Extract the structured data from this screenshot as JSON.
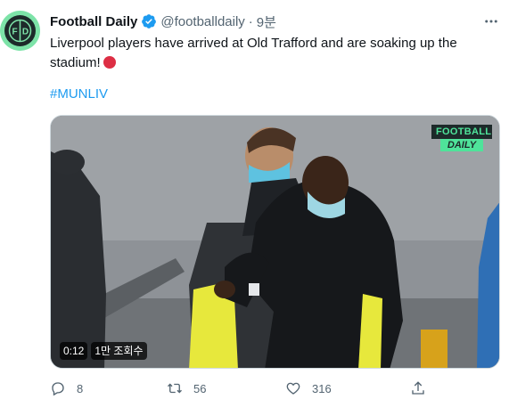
{
  "tweet": {
    "author_name": "Football Daily",
    "handle": "@footballdaily",
    "separator": "·",
    "time": "9분",
    "text": "Liverpool players have arrived at Old Trafford and are soaking up the stadium!",
    "hashtag": "#MUNLIV",
    "avatar_text": "F D",
    "media": {
      "brand_top": "FOOTBALL",
      "brand_bottom": "DAILY",
      "duration": "0:12",
      "views": "1만 조회수"
    },
    "actions": {
      "replies": "8",
      "retweets": "56",
      "likes": "316"
    }
  },
  "colors": {
    "verified": "#1d9bf0",
    "link": "#1d9bf0",
    "muted": "#536471",
    "avatar_ring": "#7de3a8",
    "brand_green": "#4fe39a"
  }
}
